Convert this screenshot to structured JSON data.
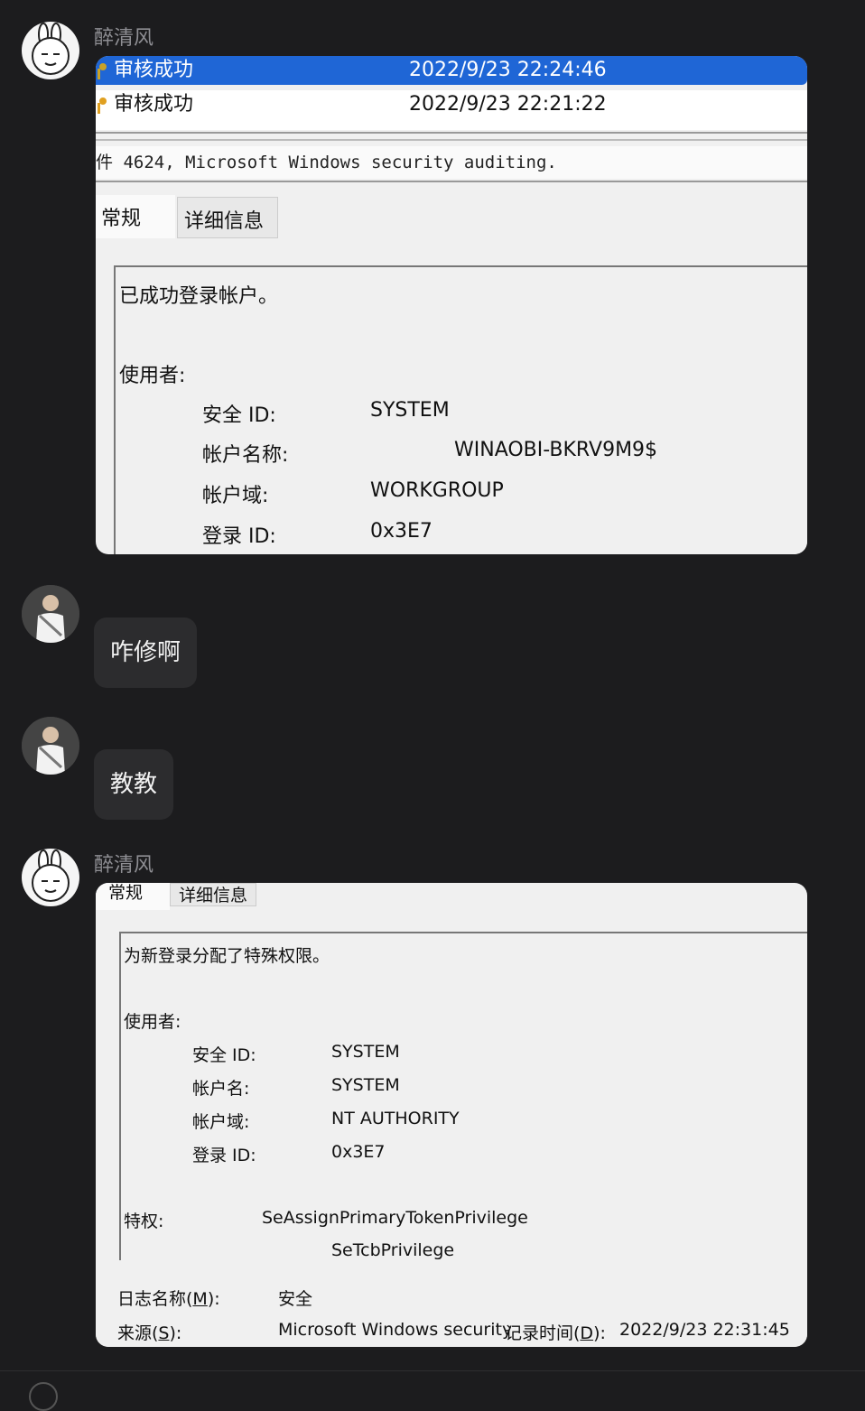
{
  "messages": [
    {
      "sender": "醉清风"
    },
    {
      "text": "咋修啊"
    },
    {
      "text": "教教"
    },
    {
      "sender": "醉清风"
    }
  ],
  "shot1": {
    "rows": [
      {
        "name": "审核成功",
        "date": "2022/9/23 22:24:46"
      },
      {
        "name": "审核成功",
        "date": "2022/9/23 22:21:22"
      }
    ],
    "event_title": "件 4624, Microsoft Windows security auditing.",
    "tabs": [
      "常规",
      "详细信息"
    ],
    "summary": "已成功登录帐户。",
    "subject_label": "使用者:",
    "fields": [
      {
        "k": "安全 ID:",
        "v": "SYSTEM"
      },
      {
        "k": "帐户名称:",
        "v": "WINAOBI-BKRV9M9$"
      },
      {
        "k": "帐户域:",
        "v": "WORKGROUP"
      },
      {
        "k": "登录 ID:",
        "v": "0x3E7"
      }
    ]
  },
  "shot2": {
    "tabs": [
      "常规",
      "详细信息"
    ],
    "summary": "为新登录分配了特殊权限。",
    "subject_label": "使用者:",
    "fields": [
      {
        "k": "安全 ID:",
        "v": "SYSTEM"
      },
      {
        "k": "帐户名:",
        "v": "SYSTEM"
      },
      {
        "k": "帐户域:",
        "v": "NT AUTHORITY"
      },
      {
        "k": "登录 ID:",
        "v": "0x3E7"
      }
    ],
    "privileges_label": "特权:",
    "privileges": [
      "SeAssignPrimaryTokenPrivilege",
      "SeTcbPrivilege"
    ],
    "log_name_label": "日志名称(",
    "log_name_key": "M",
    "log_name_value": "安全",
    "source_label": "来源(",
    "source_key": "S",
    "source_value": "Microsoft Windows security",
    "logged_label": "记录时间(",
    "logged_key": "D",
    "logged_value": "2022/9/23 22:31:45",
    "close_paren": "):"
  }
}
